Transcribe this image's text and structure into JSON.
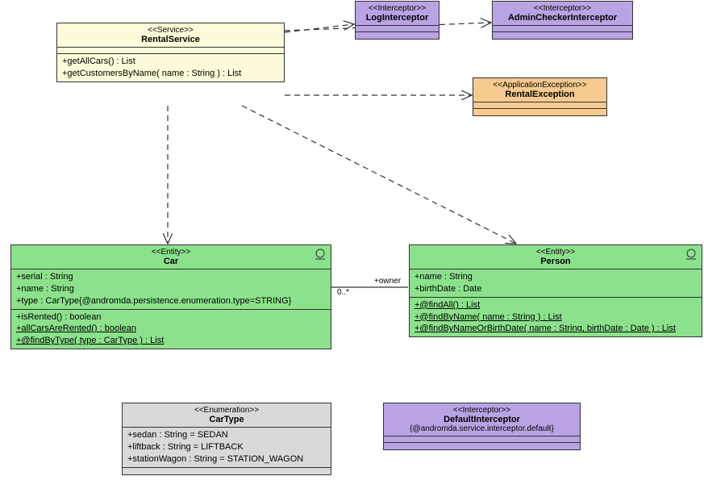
{
  "service": {
    "stereotype": "<<Service>>",
    "name": "RentalService",
    "ops": [
      "+getAllCars() : List",
      "+getCustomersByName( name : String ) : List"
    ]
  },
  "logInterceptor": {
    "stereotype": "<<Interceptor>>",
    "name": "LogInterceptor"
  },
  "adminInterceptor": {
    "stereotype": "<<Interceptor>>",
    "name": "AdminCheckerInterceptor"
  },
  "rentalException": {
    "stereotype": "<<ApplicationException>>",
    "name": "RentalException"
  },
  "car": {
    "stereotype": "<<Entity>>",
    "name": "Car",
    "attrs": [
      "+serial : String",
      "+name : String",
      "+type : CarType{@andromda.persistence.enumeration.type=STRING}"
    ],
    "ops": {
      "isRented": "+isRented() : boolean",
      "allCarsAreRented": "+allCarsAreRented() : boolean",
      "findByType": "+@findByType( type : CarType ) : List"
    }
  },
  "person": {
    "stereotype": "<<Entity>>",
    "name": "Person",
    "attrs": [
      "+name : String",
      "+birthDate : Date"
    ],
    "ops": {
      "findAll": "+@findAll() : List",
      "findByName": "+@findByName( name : String ) : List",
      "findByNameOrBirthDate": "+@findByNameOrBirthDate( name : String, birthDate : Date ) : List"
    }
  },
  "carType": {
    "stereotype": "<<Enumeration>>",
    "name": "CarType",
    "attrs": [
      "+sedan : String = SEDAN",
      "+liftback : String = LIFTBACK",
      "+stationWagon : String = STATION_WAGON"
    ]
  },
  "defaultInterceptor": {
    "stereotype": "<<Interceptor>>",
    "name": "DefaultInterceptor",
    "constraint": "{@andromda.service.interceptor.default}"
  },
  "assoc": {
    "mult": "0..*",
    "owner": "+owner"
  }
}
